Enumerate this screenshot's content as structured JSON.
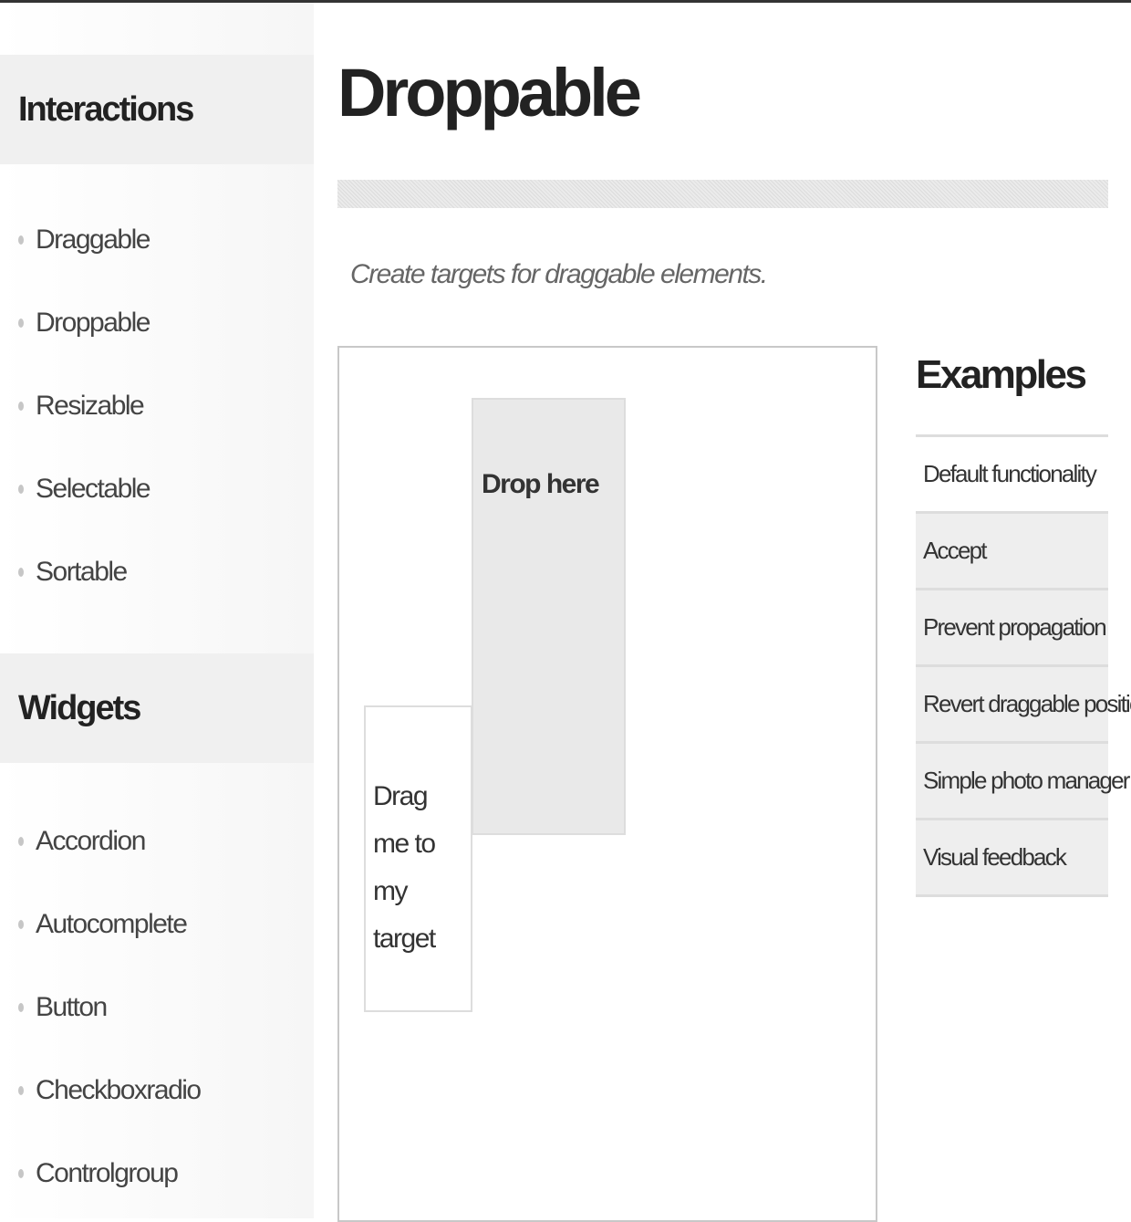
{
  "sidebar": {
    "interactions": {
      "heading": "Interactions",
      "items": [
        "Draggable",
        "Droppable",
        "Resizable",
        "Selectable",
        "Sortable"
      ]
    },
    "widgets": {
      "heading": "Widgets",
      "items": [
        "Accordion",
        "Autocomplete",
        "Button",
        "Checkboxradio",
        "Controlgroup"
      ]
    }
  },
  "main": {
    "title": "Droppable",
    "subtitle": "Create targets for draggable elements.",
    "demo": {
      "droppable_label": "Drop here",
      "draggable_label": "Drag me to my target"
    }
  },
  "examples": {
    "heading": "Examples",
    "items": [
      "Default functionality",
      "Accept",
      "Prevent propagation",
      "Revert draggable position",
      "Simple photo manager",
      "Visual feedback"
    ],
    "active": "Default functionality"
  },
  "colors": {
    "heading_bg": "#f0f0f0",
    "droppable_bg": "#e9e9e9",
    "example_bg": "#eeeeee",
    "border": "#dddddd",
    "bullet": "#c6c6c6"
  }
}
